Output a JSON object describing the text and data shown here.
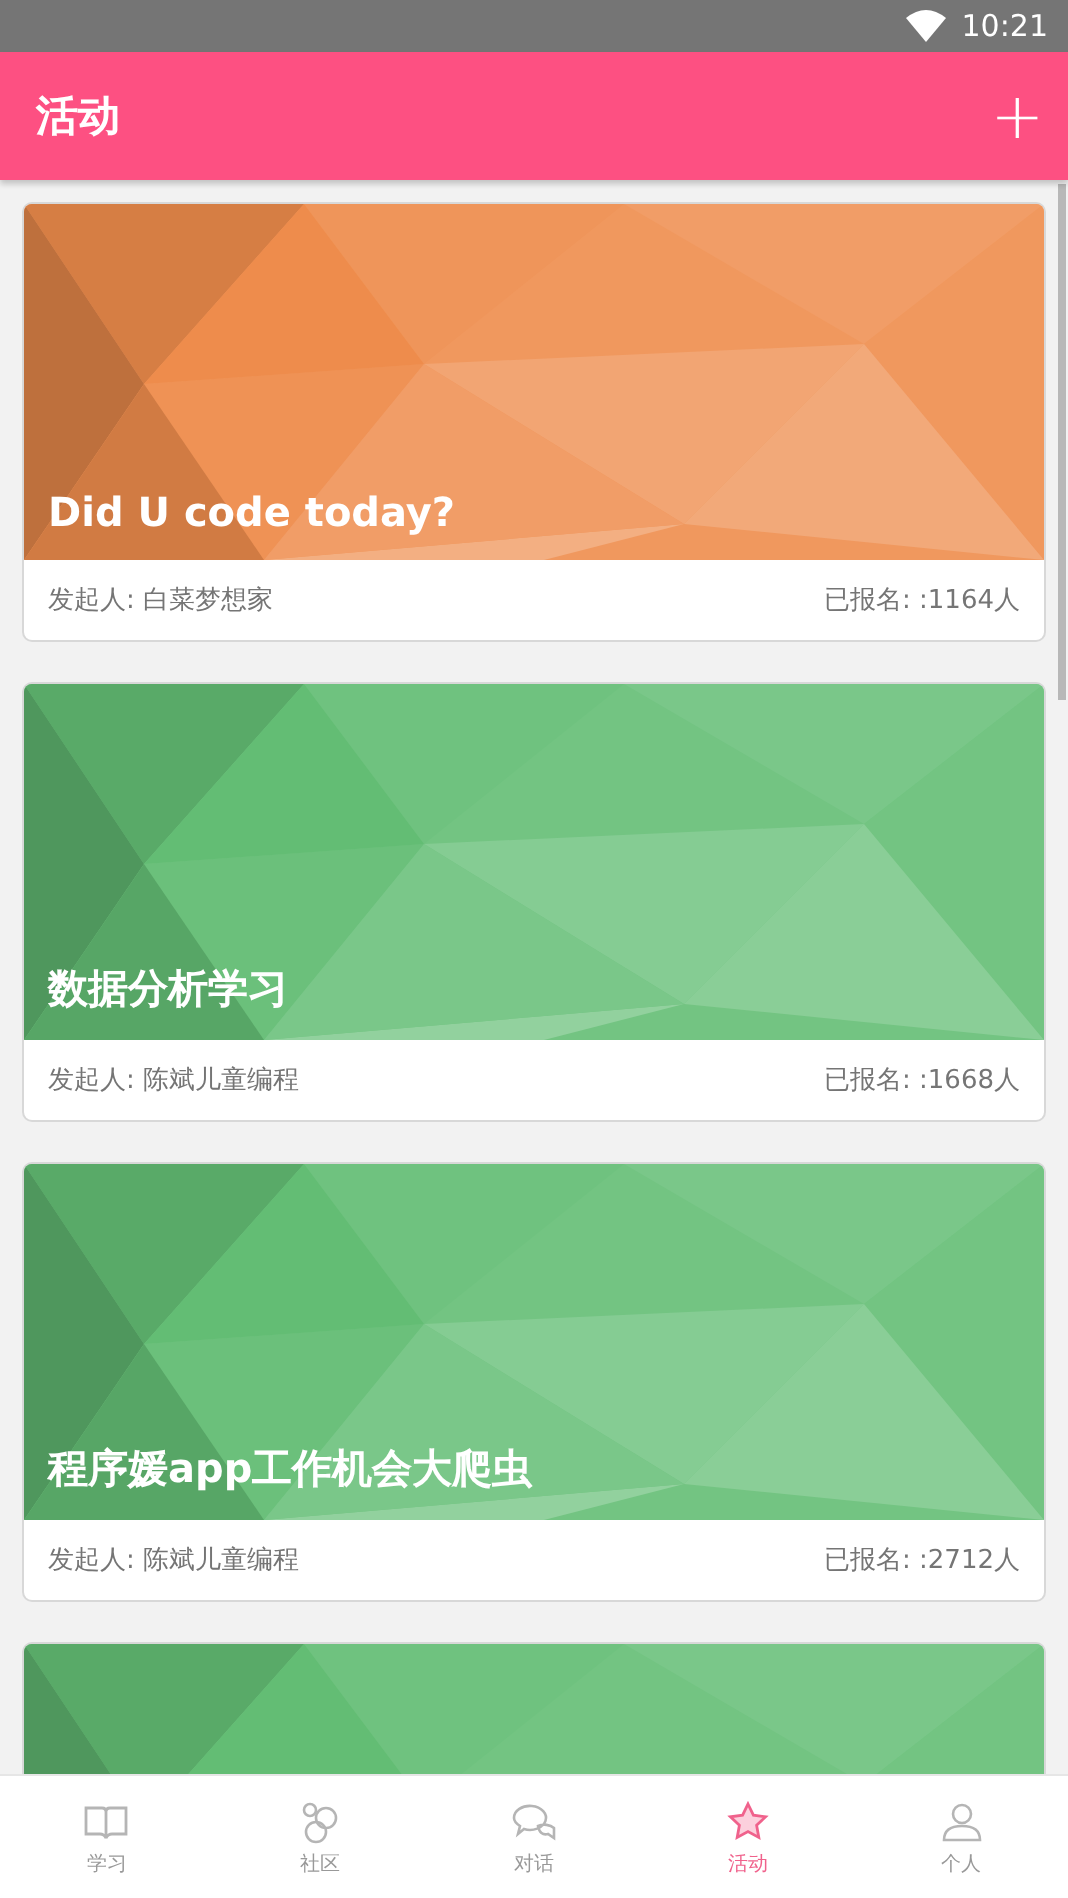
{
  "status_bar": {
    "time": "10:21"
  },
  "app_bar": {
    "title": "活动",
    "action": "+"
  },
  "events": [
    {
      "title": "Did U code today?",
      "organizer": "发起人: 白菜梦想家",
      "signups": "已报名: :1164人",
      "color": "#ee8c4c"
    },
    {
      "title": "数据分析学习",
      "organizer": "发起人: 陈斌儿童编程",
      "signups": "已报名: :1668人",
      "color": "#63bd74"
    },
    {
      "title": "程序媛app工作机会大爬虫",
      "organizer": "发起人: 陈斌儿童编程",
      "signups": "已报名: :2712人",
      "color": "#63bd74"
    },
    {
      "color": "#63bd74"
    }
  ],
  "tabs": [
    {
      "label": "学习",
      "kind": "book",
      "selected": false
    },
    {
      "label": "社区",
      "kind": "bubbles",
      "selected": false
    },
    {
      "label": "对话",
      "kind": "chat",
      "selected": false
    },
    {
      "label": "活动",
      "kind": "star",
      "selected": true
    },
    {
      "label": "个人",
      "kind": "person",
      "selected": false
    }
  ]
}
